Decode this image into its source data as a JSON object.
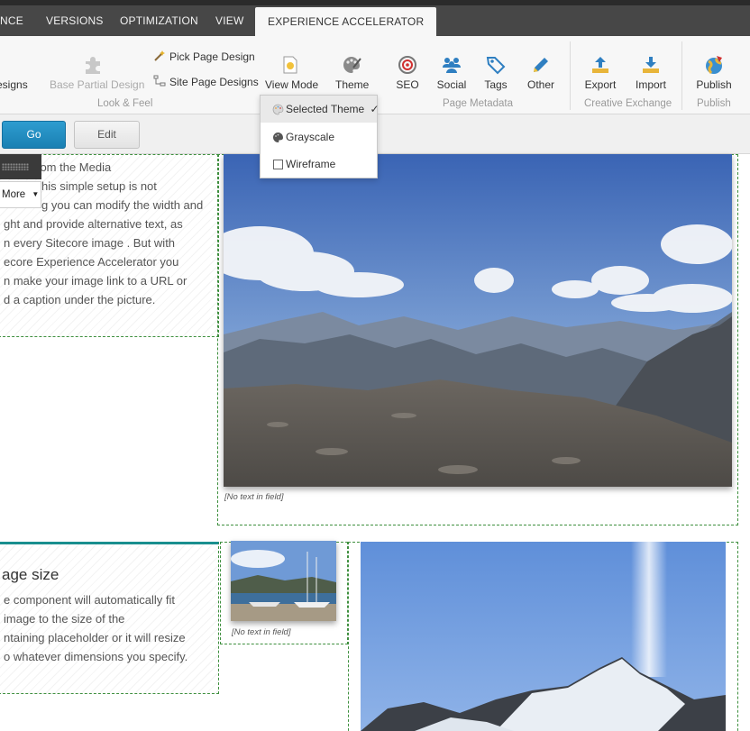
{
  "tabs": [
    {
      "label": "NCE"
    },
    {
      "label": "VERSIONS"
    },
    {
      "label": "OPTIMIZATION"
    },
    {
      "label": "VIEW"
    },
    {
      "label": "EXPERIENCE ACCELERATOR"
    }
  ],
  "ribbon": {
    "designs_partial": "esigns",
    "base_partial_design": "Base Partial Design",
    "pick_page_design": "Pick Page Design",
    "site_page_designs": "Site Page Designs",
    "view_mode": "View Mode",
    "theme": "Theme",
    "seo": "SEO",
    "social": "Social",
    "tags": "Tags",
    "other": "Other",
    "export": "Export",
    "import": "Import",
    "publish": "Publish",
    "groups": {
      "look_feel": "Look & Feel",
      "page_metadata": "Page Metadata",
      "creative_exchange": "Creative Exchange",
      "publish": "Publish"
    }
  },
  "toolbar": {
    "go_label": "Go",
    "edit_label": "Edit"
  },
  "more_popup": {
    "more_label": "More"
  },
  "view_mode_menu": {
    "items": [
      {
        "label": "Selected Theme",
        "check": "✓"
      },
      {
        "label": "Grayscale"
      },
      {
        "label": "Wireframe"
      }
    ]
  },
  "content": {
    "block1_lines": [
      "cture from the Media",
      "his simple setup is not",
      "g you can modify the width and",
      "ght and provide alternative text, as",
      "n every Sitecore image . But with",
      "ecore Experience Accelerator you",
      "n make your image link to a URL or",
      "d a caption under the picture."
    ],
    "image1_caption": "[No text in field]",
    "block2_heading": "age size",
    "block2_lines": [
      "e component will automatically fit",
      " image to the size of the",
      "ntaining placeholder or it will resize",
      "o whatever dimensions you specify."
    ],
    "thumb_caption": "[No text in field]"
  },
  "colors": {
    "tabbar": "#474747",
    "ribbon": "#f7f7f7",
    "go_button": "#1f8cc0",
    "dashed_border": "#3e8f3e"
  }
}
